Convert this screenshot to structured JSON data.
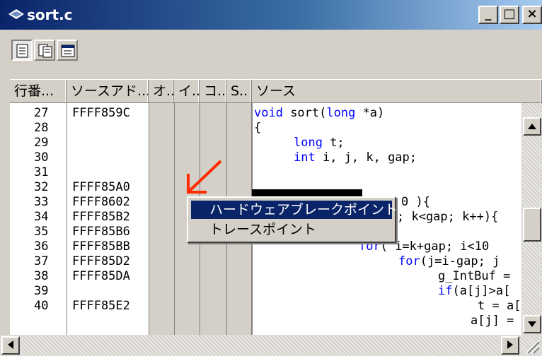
{
  "window": {
    "title": "sort.c",
    "minimize": "_",
    "maximize": "□",
    "close": "×"
  },
  "toolbar": {
    "buttons": [
      "source-view-icon",
      "disassembly-view-icon",
      "mixed-view-icon"
    ]
  },
  "columns": [
    "行番...",
    "ソースアド...",
    "オ..",
    "イ..",
    "コ..",
    "S..",
    "ソース"
  ],
  "rows": [
    {
      "line": "27",
      "addr": "FFFF859C"
    },
    {
      "line": "28",
      "addr": ""
    },
    {
      "line": "29",
      "addr": ""
    },
    {
      "line": "30",
      "addr": ""
    },
    {
      "line": "31",
      "addr": ""
    },
    {
      "line": "32",
      "addr": "FFFF85A0"
    },
    {
      "line": "33",
      "addr": "FFFF8602"
    },
    {
      "line": "34",
      "addr": "FFFF85B2"
    },
    {
      "line": "35",
      "addr": "FFFF85B6"
    },
    {
      "line": "36",
      "addr": "FFFF85BB"
    },
    {
      "line": "37",
      "addr": "FFFF85D2"
    },
    {
      "line": "38",
      "addr": "FFFF85DA"
    },
    {
      "line": "39",
      "addr": ""
    },
    {
      "line": "40",
      "addr": "FFFF85E2"
    }
  ],
  "source": {
    "l27_kw": "void",
    "l27_txt": " sort(",
    "l27_kw2": "long",
    "l27_txt2": " *a)",
    "l28": "{",
    "l29_kw": "long",
    "l29_txt": " t;",
    "l30_kw": "int",
    "l30_txt": " i, j, k, gap;",
    "l33": "0 ){",
    "l34": "; k<gap; k++){",
    "l35_kw": "for",
    "l35_txt": "( i=k+gap; i<10",
    "l36_kw": "for",
    "l36_txt": "(j=i-gap; j",
    "l37": "g_IntBuf =",
    "l38_kw": "if",
    "l38_txt": "(a[j]>a[",
    "l39": "t = a[",
    "l40": "a[j] ="
  },
  "context_menu": {
    "items": [
      "ハードウェアブレークポイント",
      "トレースポイント"
    ],
    "selected_index": 0
  },
  "colors": {
    "accent": "#0a246a",
    "keyword": "#0000ff",
    "arrow": "#ff2a00"
  }
}
